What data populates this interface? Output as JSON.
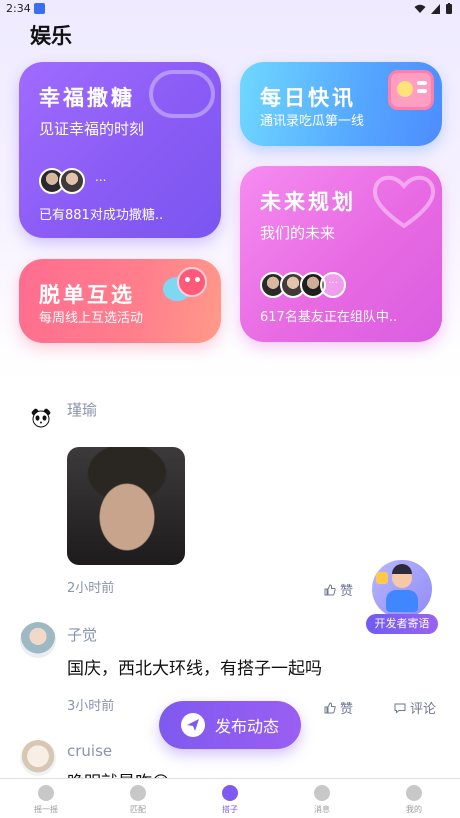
{
  "status_bar": {
    "time": "2:34",
    "icons": [
      "wifi-icon",
      "signal-icon",
      "battery-icon"
    ]
  },
  "page": {
    "title": "娱乐"
  },
  "cards": {
    "happy": {
      "title": "幸福撒糖",
      "subtitle": "见证幸福的时刻",
      "dots": "...",
      "footer": "已有881对成功撒糖.."
    },
    "news": {
      "title": "每日快讯",
      "subtitle": "通讯录吃瓜第一线"
    },
    "future": {
      "title": "未来规划",
      "subtitle": "我们的未来",
      "more": "···",
      "footer": "617名基友正在组队中.."
    },
    "single": {
      "title": "脱单互选",
      "subtitle": "每周线上互选活动"
    }
  },
  "posts": [
    {
      "name": "瑾瑜",
      "time": "2小时前",
      "like_label": "赞"
    },
    {
      "name": "子觉",
      "text": "国庆，西北大环线，有搭子一起吗",
      "time": "3小时前",
      "like_label": "赞",
      "comment_label": "评论"
    },
    {
      "name": "cruise",
      "text": "晚明就是咋😊"
    }
  ],
  "floating_badge": {
    "label": "开发者寄语"
  },
  "publish": {
    "label": "发布动态"
  },
  "bottom_nav": [
    {
      "label": "摇一摇",
      "active": false
    },
    {
      "label": "匹配",
      "active": false
    },
    {
      "label": "搭子",
      "active": true
    },
    {
      "label": "消息",
      "active": false
    },
    {
      "label": "我的",
      "active": false
    }
  ],
  "colors": {
    "accent": "#7f5af0",
    "happy": "#8a5cf5",
    "news": "#55a6ff",
    "future": "#e86ae3",
    "single": "#ff7f8c",
    "meta": "#8a93b0"
  }
}
